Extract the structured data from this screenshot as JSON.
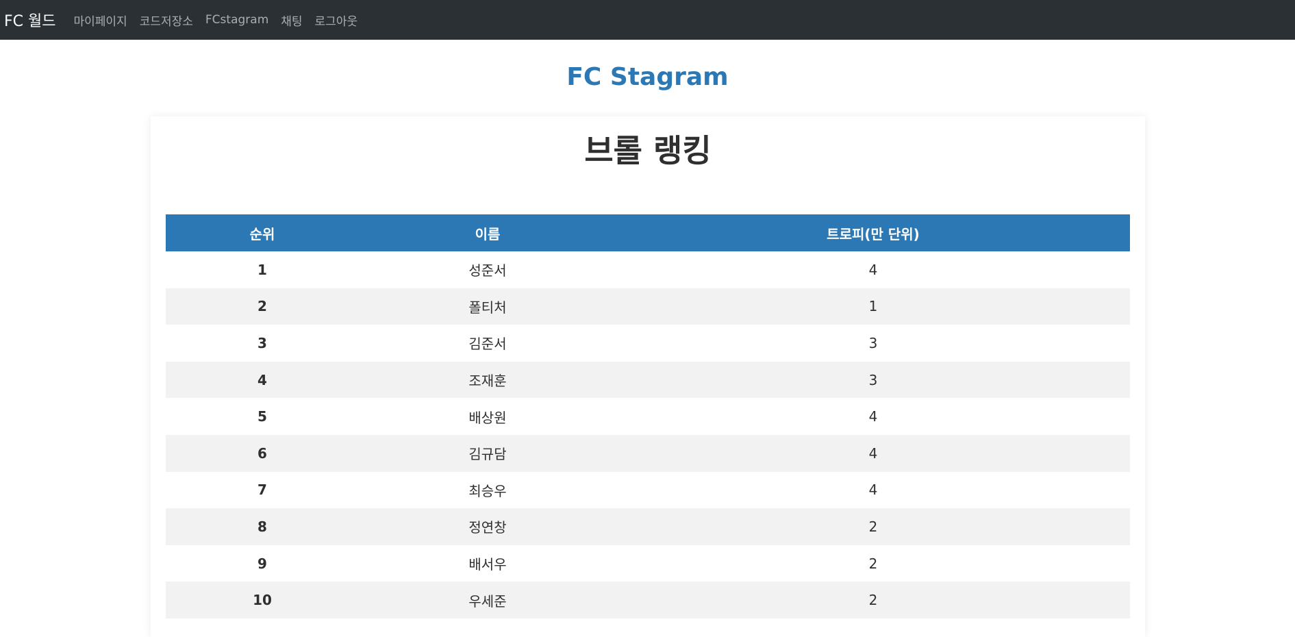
{
  "navbar": {
    "brand": "FC 월드",
    "links": [
      "마이페이지",
      "코드저장소",
      "FCstagram",
      "채팅",
      "로그아웃"
    ]
  },
  "page": {
    "title": "FC Stagram"
  },
  "ranking": {
    "title": "브롤 랭킹",
    "columns": [
      "순위",
      "이름",
      "트로피(만 단위)"
    ],
    "rows": [
      {
        "rank": "1",
        "name": "성준서",
        "trophies": "4"
      },
      {
        "rank": "2",
        "name": "폴티처",
        "trophies": "1"
      },
      {
        "rank": "3",
        "name": "김준서",
        "trophies": "3"
      },
      {
        "rank": "4",
        "name": "조재훈",
        "trophies": "3"
      },
      {
        "rank": "5",
        "name": "배상원",
        "trophies": "4"
      },
      {
        "rank": "6",
        "name": "김규담",
        "trophies": "4"
      },
      {
        "rank": "7",
        "name": "최승우",
        "trophies": "4"
      },
      {
        "rank": "8",
        "name": "정연창",
        "trophies": "2"
      },
      {
        "rank": "9",
        "name": "배서우",
        "trophies": "2"
      },
      {
        "rank": "10",
        "name": "우세준",
        "trophies": "2"
      }
    ]
  },
  "colors": {
    "navbar_bg": "#2b3035",
    "accent": "#2b78b5",
    "stripe": "#f2f2f2"
  }
}
